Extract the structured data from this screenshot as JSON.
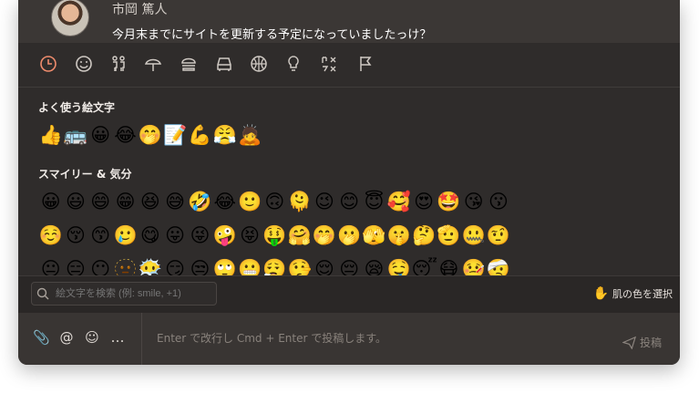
{
  "message": {
    "author": "市岡 篤人",
    "text": "今月末までにサイトを更新する予定になっていましたっけ？"
  },
  "categories": [
    {
      "name": "recent",
      "icon": "clock-icon",
      "glyph": "◷"
    },
    {
      "name": "smileys",
      "icon": "smiley-icon",
      "glyph": "☺"
    },
    {
      "name": "people",
      "icon": "people-icon",
      "glyph": "⚇"
    },
    {
      "name": "nature",
      "icon": "nature-icon",
      "glyph": "⛱"
    },
    {
      "name": "food",
      "icon": "food-icon",
      "glyph": "🍔"
    },
    {
      "name": "travel",
      "icon": "car-icon",
      "glyph": "🚗"
    },
    {
      "name": "activity",
      "icon": "ball-icon",
      "glyph": "⚽"
    },
    {
      "name": "objects",
      "icon": "bulb-icon",
      "glyph": "💡"
    },
    {
      "name": "symbols",
      "icon": "symbols-icon",
      "glyph": "♫"
    },
    {
      "name": "flags",
      "icon": "flag-icon",
      "glyph": "⚐"
    }
  ],
  "sections": {
    "frequent_title": "よく使う絵文字",
    "smileys_title": "スマイリー & 気分"
  },
  "frequent": [
    "👍",
    "🚌",
    "😀",
    "😂",
    "🤭",
    "📝",
    "💪",
    "😤",
    "🙇"
  ],
  "smileys_rows": [
    [
      "😀",
      "😃",
      "😄",
      "😁",
      "😆",
      "😅",
      "🤣",
      "😂",
      "🙂",
      "🙃",
      "🫠",
      "😉",
      "😊",
      "😇",
      "🥰",
      "😍",
      "🤩",
      "😘",
      "😗"
    ],
    [
      "☺️",
      "😚",
      "😙",
      "🥲",
      "😋",
      "😛",
      "😜",
      "🤪",
      "😝",
      "🤑",
      "🤗",
      "🤭",
      "🫢",
      "🫣",
      "🤫",
      "🤔",
      "🫡",
      "🤐",
      "🤨"
    ],
    [
      "😐",
      "😑",
      "😶",
      "🫥",
      "😶‍🌫️",
      "😏",
      "😒",
      "🙄",
      "😬",
      "😮‍💨",
      "🤥",
      "😌",
      "😔",
      "😪",
      "🤤",
      "😴",
      "😷",
      "🤒",
      "🤕"
    ]
  ],
  "search": {
    "placeholder": "絵文字を検索 (例: smile, +1)",
    "icon": "search-icon"
  },
  "skin_tone": {
    "glyph": "✋",
    "label": "肌の色を選択"
  },
  "composer": {
    "tools": [
      {
        "name": "attach-icon",
        "glyph": "📎"
      },
      {
        "name": "mention-icon",
        "glyph": "@"
      },
      {
        "name": "emoji-icon",
        "glyph": "☺"
      },
      {
        "name": "more-icon",
        "glyph": "…"
      }
    ],
    "placeholder": "Enter で改行し Cmd + Enter で投稿します。",
    "post_label": "投稿"
  },
  "colors": {
    "accent": "#ef8c6d",
    "background": "#2f2c2b"
  }
}
